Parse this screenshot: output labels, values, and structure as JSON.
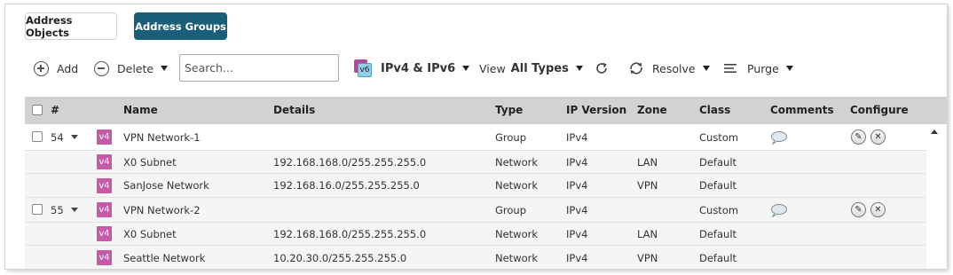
{
  "tabs": [
    {
      "label": "Address Objects",
      "active": false
    },
    {
      "label": "Address Groups",
      "active": true
    }
  ],
  "toolbar": {
    "add_label": "Add",
    "delete_label": "Delete",
    "search_placeholder": "Search...",
    "ip_filter_icon_text": "v6",
    "ip_filter_label": "IPv4 & IPv6",
    "view_label": "View",
    "view_value": "All Types",
    "resolve_label": "Resolve",
    "purge_label": "Purge"
  },
  "table": {
    "columns": [
      "#",
      "Name",
      "Details",
      "Type",
      "IP Version",
      "Zone",
      "Class",
      "Comments",
      "Configure"
    ],
    "rows": [
      {
        "kind": "group",
        "num": "54",
        "badge": "v4",
        "name": "VPN Network-1",
        "details": "",
        "type": "Group",
        "ipver": "IPv4",
        "zone": "",
        "class": "Custom"
      },
      {
        "kind": "member",
        "badge": "v4",
        "name": "X0 Subnet",
        "details": "192.168.168.0/255.255.255.0",
        "type": "Network",
        "ipver": "IPv4",
        "zone": "LAN",
        "class": "Default"
      },
      {
        "kind": "member",
        "badge": "v4",
        "name": "SanJose Network",
        "details": "192.168.16.0/255.255.255.0",
        "type": "Network",
        "ipver": "IPv4",
        "zone": "VPN",
        "class": "Default"
      },
      {
        "kind": "group",
        "num": "55",
        "badge": "v4",
        "name": "VPN Network-2",
        "details": "",
        "type": "Group",
        "ipver": "IPv4",
        "zone": "",
        "class": "Custom"
      },
      {
        "kind": "member",
        "badge": "v4",
        "name": "X0 Subnet",
        "details": "192.168.168.0/255.255.255.0",
        "type": "Network",
        "ipver": "IPv4",
        "zone": "LAN",
        "class": "Default"
      },
      {
        "kind": "member",
        "badge": "v4",
        "name": "Seattle Network",
        "details": "10.20.30.0/255.255.255.0",
        "type": "Network",
        "ipver": "IPv4",
        "zone": "VPN",
        "class": "Default"
      }
    ]
  },
  "colors": {
    "active_tab": "#1a5f7a",
    "v4_badge": "#c75aa6",
    "header_bg": "#d2d2d2"
  }
}
